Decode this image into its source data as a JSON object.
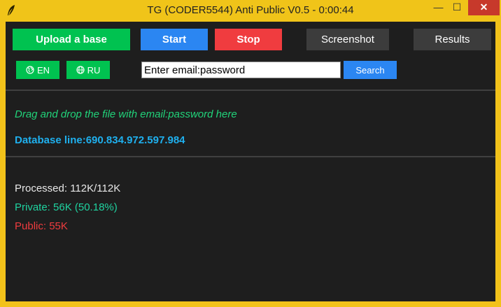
{
  "window": {
    "title": "TG (CODER5544) Anti Public V0.5 - 0:00:44",
    "minimize_glyph": "—",
    "maximize_glyph": "☐",
    "close_glyph": "✕"
  },
  "toolbar": {
    "upload_label": "Upload a base",
    "start_label": "Start",
    "stop_label": "Stop",
    "screenshot_label": "Screenshot",
    "results_label": "Results"
  },
  "language": {
    "en_label": "EN",
    "ru_label": "RU"
  },
  "search": {
    "value": "Enter email:password",
    "button_label": "Search"
  },
  "drop_area": {
    "hint": "Drag and drop the file with email:password here",
    "database_line": "Database line:690.834.972.597.984"
  },
  "stats": {
    "processed": "Processed: 112K/112K",
    "private": "Private: 56K (50.18%)",
    "public": "Public: 55K"
  },
  "colors": {
    "frame": "#f0c419",
    "background": "#1e1e1e",
    "green": "#00c250",
    "blue": "#2b86f2",
    "red": "#f03c3f",
    "gray_button": "#3c3c3c",
    "hint_green": "#21d37a",
    "db_blue": "#1fb0ee",
    "private_teal": "#1fd3a0"
  }
}
